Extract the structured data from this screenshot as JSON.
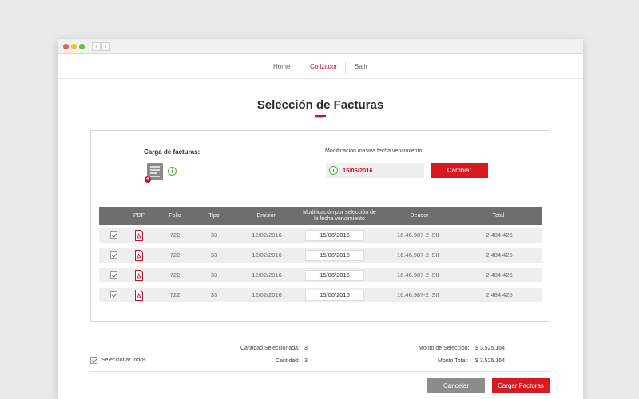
{
  "nav": {
    "home": "Home",
    "cotizador": "Cotizador",
    "salir": "Salir"
  },
  "page": {
    "title": "Selección de Facturas"
  },
  "upload": {
    "label": "Carga de facturas:",
    "icon": "document-upload-icon"
  },
  "mass_update": {
    "label": "Modificación masiva fecha vencimiento",
    "date_value": "15/06/2016",
    "button_label": "Cambiar"
  },
  "table": {
    "headers": {
      "pdf": "PDF",
      "folio": "Folio",
      "tipo": "Tipo",
      "emision": "Emisión",
      "modificacion": "Modificación por selección de la fecha vencimiento",
      "deudor": "Deudor",
      "total": "Total"
    },
    "rows": [
      {
        "folio": "722",
        "tipo": "33",
        "emision": "12/02/2016",
        "vencimiento": "15/06/2016",
        "deudor": "16.46.987-2",
        "sii": "SII",
        "total": "2.484.425"
      },
      {
        "folio": "722",
        "tipo": "33",
        "emision": "12/02/2016",
        "vencimiento": "15/06/2016",
        "deudor": "16.46.987-2",
        "sii": "SII",
        "total": "2.484.425"
      },
      {
        "folio": "722",
        "tipo": "33",
        "emision": "12/02/2016",
        "vencimiento": "15/06/2016",
        "deudor": "16.46.987-2",
        "sii": "SII",
        "total": "2.484.425"
      },
      {
        "folio": "722",
        "tipo": "33",
        "emision": "12/02/2016",
        "vencimiento": "15/06/2016",
        "deudor": "16.46.987-2",
        "sii": "SII",
        "total": "2.484.425"
      }
    ]
  },
  "footer": {
    "select_all": "Seleccionar todos",
    "cantidad_seleccionada_label": "Cantidad Seleccionada:",
    "cantidad_seleccionada": "3",
    "cantidad_label": "Cantidad:",
    "cantidad": "3",
    "monto_seleccion_label": "Monto de Selección:",
    "monto_seleccion": "$ 3.525.164",
    "monto_total_label": "Monto Total:",
    "monto_total": "$ 3.525.164",
    "cancel_label": "Cancelar",
    "submit_label": "Cargar Facturas"
  },
  "colors": {
    "accent": "#d71920",
    "header_gray": "#6e6e6e",
    "row_gray": "#eeeeee",
    "info_green": "#4cae3a"
  }
}
